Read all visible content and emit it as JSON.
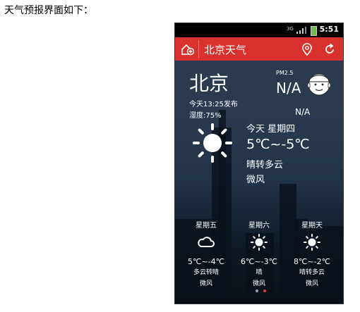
{
  "caption": "天气预报界面如下：",
  "status_bar": {
    "network": "3G",
    "time": "5:51"
  },
  "app_bar": {
    "title": "北京天气",
    "icons": [
      "add-city-icon",
      "location-pin-icon",
      "refresh-icon"
    ],
    "color": "#d9322e"
  },
  "current": {
    "city": "北京",
    "publish_time": "今天13:25发布",
    "humidity": "湿度:75%",
    "pm_label": "PM2.5",
    "pm_value": "N/A",
    "air_quality": "N/A",
    "day_label": "今天 星期四",
    "temp_range": "5℃~-5℃",
    "condition": "晴转多云",
    "wind": "微风",
    "icon": "sun-icon"
  },
  "forecast": [
    {
      "day": "星期五",
      "temp": "5℃~-4℃",
      "condition": "多云转晴",
      "wind": "微风",
      "icon": "cloud-icon"
    },
    {
      "day": "星期六",
      "temp": "6℃~-3℃",
      "condition": "晴",
      "wind": "微风",
      "icon": "sun-icon"
    },
    {
      "day": "星期天",
      "temp": "8℃~-2℃",
      "condition": "晴转多云",
      "wind": "微风",
      "icon": "sun-icon"
    }
  ],
  "pager": {
    "pages": 2,
    "active": 2
  }
}
